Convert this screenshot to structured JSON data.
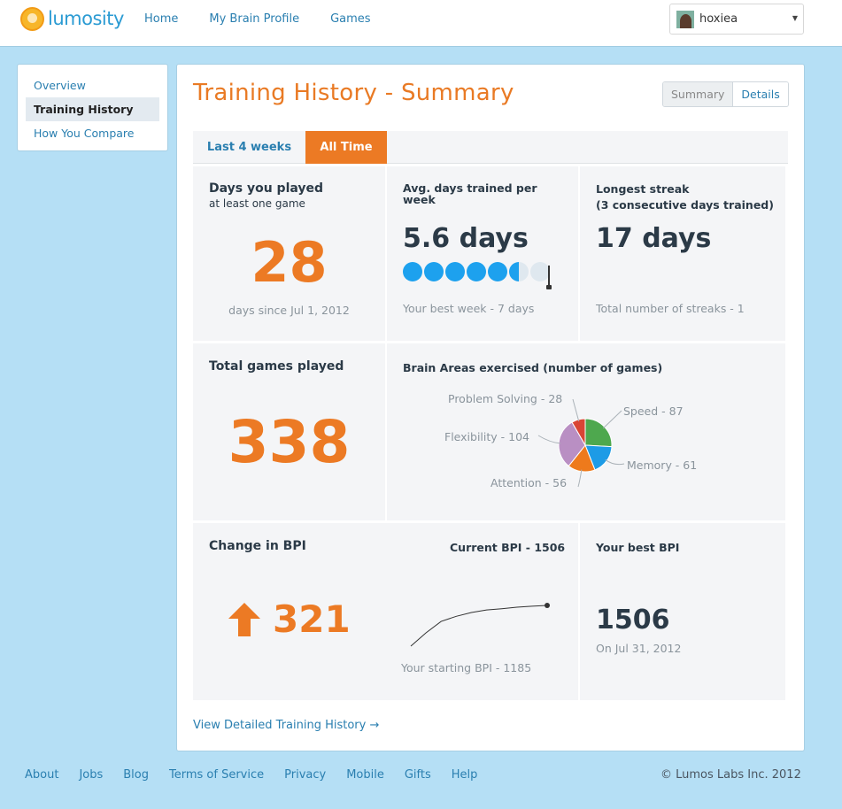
{
  "brand": {
    "name": "lumosity"
  },
  "nav": {
    "items": [
      "Home",
      "My Brain Profile",
      "Games"
    ]
  },
  "user": {
    "name": "hoxiea"
  },
  "sidebar": {
    "items": [
      {
        "label": "Overview"
      },
      {
        "label": "Training History"
      },
      {
        "label": "How You Compare"
      }
    ]
  },
  "page": {
    "title": "Training History - Summary",
    "toggle": {
      "summary": "Summary",
      "details": "Details"
    },
    "tabs": [
      "Last 4 weeks",
      "All Time"
    ]
  },
  "stats": {
    "days_played": {
      "title": "Days you played",
      "subtitle": "at least one game",
      "value": "28",
      "footnote": "days since Jul 1, 2012"
    },
    "avg_days": {
      "title": "Avg. days trained per week",
      "value": "5.6 days",
      "footnote": "Your best week - 7 days",
      "avg_value": 5.6,
      "best_week": 7
    },
    "longest_streak": {
      "title": "Longest streak",
      "subtitle": "(3 consecutive days trained)",
      "value": "17 days",
      "footnote": "Total number of streaks - 1"
    },
    "total_games": {
      "title": "Total games played",
      "value": "338"
    },
    "brain_areas": {
      "title": "Brain Areas exercised (number of games)"
    },
    "bpi": {
      "title": "Change in BPI",
      "change": "321",
      "current": "Current BPI - 1506",
      "starting": "Your starting BPI - 1185"
    },
    "best_bpi": {
      "title": "Your best BPI",
      "value": "1506",
      "date": "On Jul 31, 2012"
    }
  },
  "chart_data": [
    {
      "type": "pie",
      "title": "Brain Areas exercised (number of games)",
      "slices": [
        {
          "label": "Speed - 87",
          "name": "Speed",
          "value": 87,
          "color": "#4ea84e"
        },
        {
          "label": "Memory - 61",
          "name": "Memory",
          "value": 61,
          "color": "#1d9be6"
        },
        {
          "label": "Attention - 56",
          "name": "Attention",
          "value": 56,
          "color": "#ee7a1c"
        },
        {
          "label": "Flexibility - 104",
          "name": "Flexibility",
          "value": 104,
          "color": "#b98fc3"
        },
        {
          "label": "Problem Solving - 28",
          "name": "Problem Solving",
          "value": 28,
          "color": "#d94535"
        }
      ]
    },
    {
      "type": "line",
      "title": "",
      "series": [
        {
          "values": [
            1185,
            1290,
            1380,
            1420,
            1450,
            1470,
            1480,
            1492,
            1500,
            1506
          ]
        }
      ]
    }
  ],
  "links": {
    "view_detailed": "View Detailed Training History →"
  },
  "footer": {
    "links": [
      "About",
      "Jobs",
      "Blog",
      "Terms of Service",
      "Privacy",
      "Mobile",
      "Gifts",
      "Help"
    ],
    "copyright": "© Lumos Labs Inc. 2012"
  },
  "icons": {
    "logo": "brain-logo-icon",
    "avatar": "user-avatar",
    "caret": "caret-down-icon",
    "arrow": "arrow-up-icon"
  },
  "colors": {
    "accent": "#ec7a24",
    "link": "#2a7fb0",
    "background": "#b5dff5",
    "dot": "#1da1ee"
  }
}
